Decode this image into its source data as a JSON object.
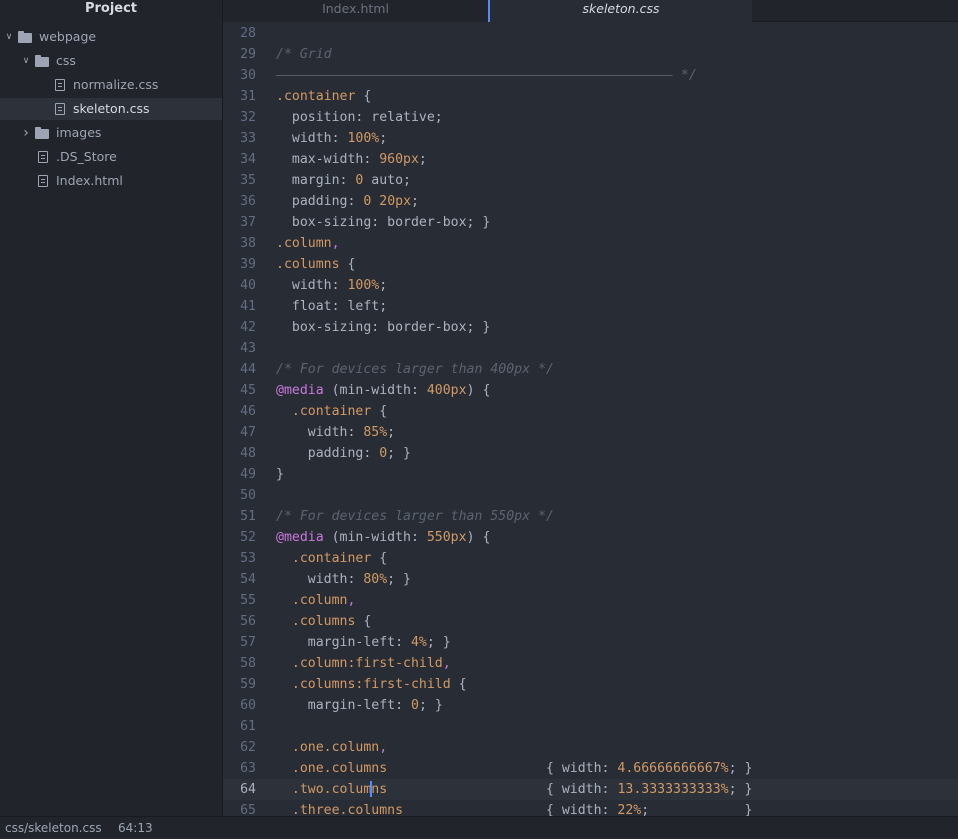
{
  "sidebar": {
    "title": "Project",
    "tree": [
      {
        "label": "webpage",
        "type": "folder",
        "expanded": true,
        "depth": 0,
        "icon": "folder-icon"
      },
      {
        "label": "css",
        "type": "folder",
        "expanded": true,
        "depth": 1,
        "icon": "folder-icon"
      },
      {
        "label": "normalize.css",
        "type": "file",
        "depth": 2,
        "icon": "file-icon"
      },
      {
        "label": "skeleton.css",
        "type": "file",
        "depth": 2,
        "selected": true,
        "icon": "file-icon"
      },
      {
        "label": "images",
        "type": "folder",
        "expanded": false,
        "depth": 1,
        "icon": "folder-icon"
      },
      {
        "label": ".DS_Store",
        "type": "file",
        "depth": 1,
        "icon": "file-icon"
      },
      {
        "label": "Index.html",
        "type": "file",
        "depth": 1,
        "icon": "file-icon"
      }
    ]
  },
  "tabs": [
    {
      "label": "Index.html",
      "active": false
    },
    {
      "label": "skeleton.css",
      "active": true
    }
  ],
  "editor": {
    "current_line": 64,
    "lines": [
      {
        "n": "28",
        "tokens": []
      },
      {
        "n": "29",
        "tokens": [
          [
            "cm",
            "/* Grid"
          ]
        ]
      },
      {
        "n": "30",
        "tokens": [
          [
            "cm",
            "–––––––––––––––––––––––––––––––––––––––––––––––––– */"
          ]
        ]
      },
      {
        "n": "31",
        "tokens": [
          [
            "sel",
            ".container"
          ],
          [
            "txt",
            " {"
          ]
        ]
      },
      {
        "n": "32",
        "tokens": [
          [
            "txt",
            "  position: relative;"
          ]
        ]
      },
      {
        "n": "33",
        "tokens": [
          [
            "txt",
            "  width: "
          ],
          [
            "num",
            "100%"
          ],
          [
            "txt",
            ";"
          ]
        ]
      },
      {
        "n": "34",
        "tokens": [
          [
            "txt",
            "  max-width: "
          ],
          [
            "num",
            "960px"
          ],
          [
            "txt",
            ";"
          ]
        ]
      },
      {
        "n": "35",
        "tokens": [
          [
            "txt",
            "  margin: "
          ],
          [
            "num",
            "0"
          ],
          [
            "txt",
            " auto;"
          ]
        ]
      },
      {
        "n": "36",
        "tokens": [
          [
            "txt",
            "  padding: "
          ],
          [
            "num",
            "0"
          ],
          [
            "txt",
            " "
          ],
          [
            "num",
            "20px"
          ],
          [
            "txt",
            ";"
          ]
        ]
      },
      {
        "n": "37",
        "tokens": [
          [
            "txt",
            "  box-sizing: border-box; }"
          ]
        ]
      },
      {
        "n": "38",
        "tokens": [
          [
            "sel",
            ".column"
          ],
          [
            "at",
            ","
          ]
        ]
      },
      {
        "n": "39",
        "tokens": [
          [
            "sel",
            ".columns"
          ],
          [
            "txt",
            " {"
          ]
        ]
      },
      {
        "n": "40",
        "tokens": [
          [
            "txt",
            "  width: "
          ],
          [
            "num",
            "100%"
          ],
          [
            "txt",
            ";"
          ]
        ]
      },
      {
        "n": "41",
        "tokens": [
          [
            "txt",
            "  float: left;"
          ]
        ]
      },
      {
        "n": "42",
        "tokens": [
          [
            "txt",
            "  box-sizing: border-box; }"
          ]
        ]
      },
      {
        "n": "43",
        "tokens": []
      },
      {
        "n": "44",
        "tokens": [
          [
            "cm",
            "/* For devices larger than 400px */"
          ]
        ]
      },
      {
        "n": "45",
        "tokens": [
          [
            "at",
            "@media"
          ],
          [
            "txt",
            " (min-width: "
          ],
          [
            "num",
            "400px"
          ],
          [
            "txt",
            ") {"
          ]
        ]
      },
      {
        "n": "46",
        "tokens": [
          [
            "txt",
            "  "
          ],
          [
            "sel",
            ".container"
          ],
          [
            "txt",
            " {"
          ]
        ]
      },
      {
        "n": "47",
        "tokens": [
          [
            "txt",
            "    width: "
          ],
          [
            "num",
            "85%"
          ],
          [
            "txt",
            ";"
          ]
        ]
      },
      {
        "n": "48",
        "tokens": [
          [
            "txt",
            "    padding: "
          ],
          [
            "num",
            "0"
          ],
          [
            "txt",
            "; }"
          ]
        ]
      },
      {
        "n": "49",
        "tokens": [
          [
            "txt",
            "}"
          ]
        ]
      },
      {
        "n": "50",
        "tokens": []
      },
      {
        "n": "51",
        "tokens": [
          [
            "cm",
            "/* For devices larger than 550px */"
          ]
        ]
      },
      {
        "n": "52",
        "tokens": [
          [
            "at",
            "@media"
          ],
          [
            "txt",
            " (min-width: "
          ],
          [
            "num",
            "550px"
          ],
          [
            "txt",
            ") {"
          ]
        ]
      },
      {
        "n": "53",
        "tokens": [
          [
            "txt",
            "  "
          ],
          [
            "sel",
            ".container"
          ],
          [
            "txt",
            " {"
          ]
        ]
      },
      {
        "n": "54",
        "tokens": [
          [
            "txt",
            "    width: "
          ],
          [
            "num",
            "80%"
          ],
          [
            "txt",
            "; }"
          ]
        ]
      },
      {
        "n": "55",
        "tokens": [
          [
            "txt",
            "  "
          ],
          [
            "sel",
            ".column"
          ],
          [
            "at",
            ","
          ]
        ]
      },
      {
        "n": "56",
        "tokens": [
          [
            "txt",
            "  "
          ],
          [
            "sel",
            ".columns"
          ],
          [
            "txt",
            " {"
          ]
        ]
      },
      {
        "n": "57",
        "tokens": [
          [
            "txt",
            "    margin-left: "
          ],
          [
            "num",
            "4%"
          ],
          [
            "txt",
            "; }"
          ]
        ]
      },
      {
        "n": "58",
        "tokens": [
          [
            "txt",
            "  "
          ],
          [
            "sel",
            ".column:first-child"
          ],
          [
            "at",
            ","
          ]
        ]
      },
      {
        "n": "59",
        "tokens": [
          [
            "txt",
            "  "
          ],
          [
            "sel",
            ".columns:first-child"
          ],
          [
            "txt",
            " {"
          ]
        ]
      },
      {
        "n": "60",
        "tokens": [
          [
            "txt",
            "    margin-left: "
          ],
          [
            "num",
            "0"
          ],
          [
            "txt",
            "; }"
          ]
        ]
      },
      {
        "n": "61",
        "tokens": []
      },
      {
        "n": "62",
        "tokens": [
          [
            "txt",
            "  "
          ],
          [
            "sel",
            ".one.column"
          ],
          [
            "at",
            ","
          ]
        ]
      },
      {
        "n": "63",
        "tokens": [
          [
            "txt",
            "  "
          ],
          [
            "sel",
            ".one.columns"
          ],
          [
            "txt",
            "                    { width: "
          ],
          [
            "num",
            "4.66666666667%"
          ],
          [
            "txt",
            "; }"
          ]
        ]
      },
      {
        "n": "64",
        "tokens": [
          [
            "txt",
            "  "
          ],
          [
            "sel",
            ".two.colum"
          ],
          [
            "caret",
            ""
          ],
          [
            "sel",
            "ns"
          ],
          [
            "txt",
            "                    { width: "
          ],
          [
            "num",
            "13.3333333333%"
          ],
          [
            "txt",
            "; }"
          ]
        ]
      },
      {
        "n": "65",
        "tokens": [
          [
            "txt",
            "  "
          ],
          [
            "sel",
            ".three.columns"
          ],
          [
            "txt",
            "                  { width: "
          ],
          [
            "num",
            "22%"
          ],
          [
            "txt",
            ";            }"
          ]
        ]
      }
    ]
  },
  "status": {
    "path": "css/skeleton.css",
    "position": "64:13"
  },
  "colors": {
    "background": "#282c34",
    "sidebar": "#21252b",
    "accent": "#568af2",
    "comment": "#5c6370",
    "number": "#d19a66",
    "keyword": "#c678dd"
  }
}
